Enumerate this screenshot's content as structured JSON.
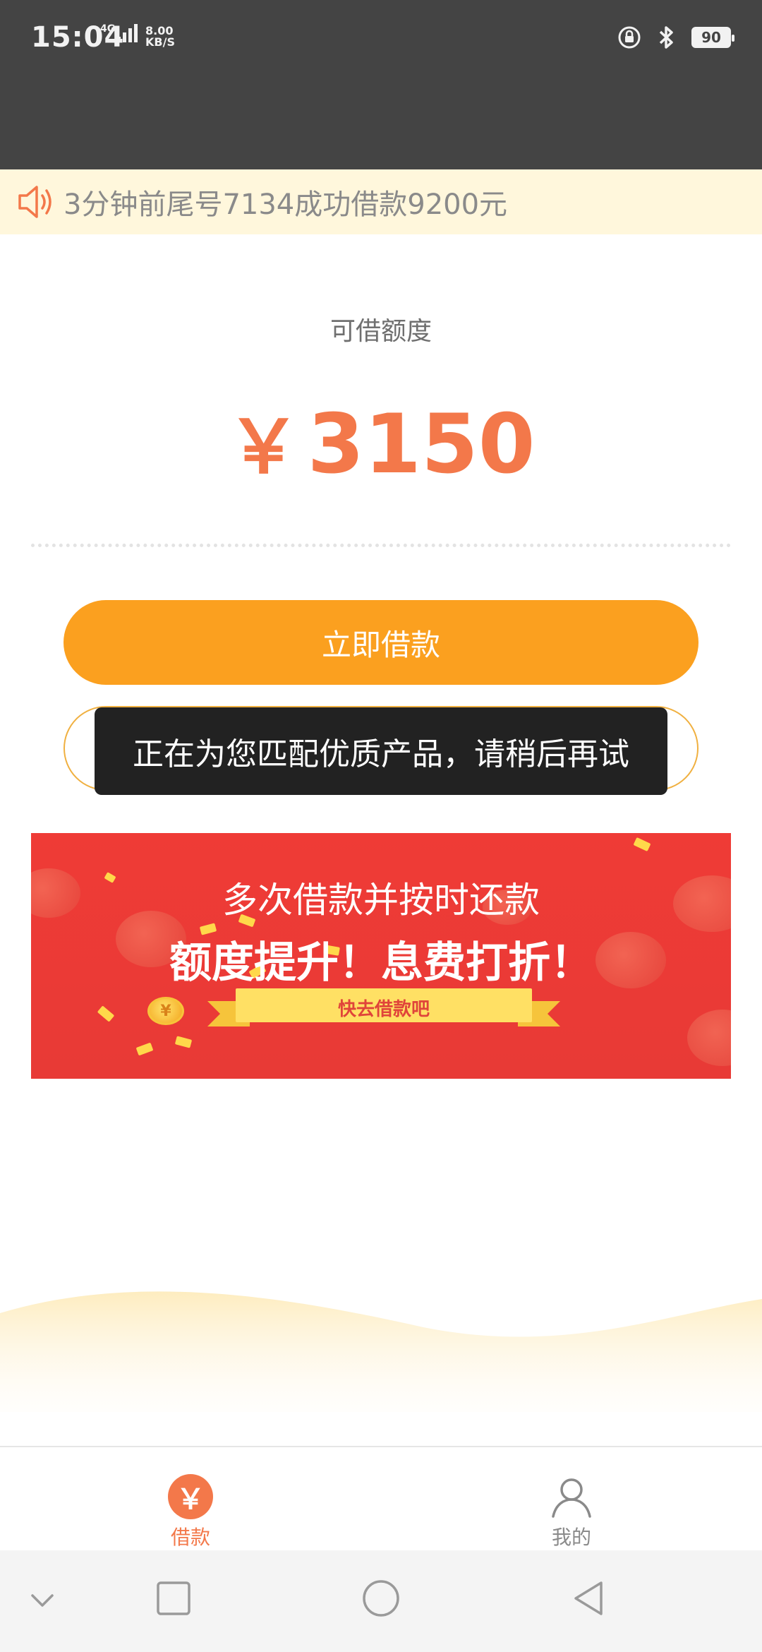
{
  "status_bar": {
    "time": "15:04",
    "network": "4G",
    "speed_value": "8.00",
    "speed_unit": "KB/S",
    "battery": "90",
    "icons": [
      "lock-rotation-icon",
      "bluetooth-icon",
      "battery-icon"
    ]
  },
  "notice": {
    "icon": "speaker-icon",
    "text": "3分钟前尾号7134成功借款9200元"
  },
  "credit": {
    "label": "可借额度",
    "currency": "￥",
    "amount": "3150"
  },
  "buttons": {
    "borrow_now": "立即借款"
  },
  "toast": {
    "text": "正在为您匹配优质产品，请稍后再试"
  },
  "promo": {
    "line1": "多次借款并按时还款",
    "line2": "额度提升！息费打折！",
    "ribbon": "快去借款吧",
    "coin_symbol": "¥"
  },
  "bottom_nav": {
    "items": [
      {
        "label": "借款",
        "icon": "yen-icon",
        "active": true
      },
      {
        "label": "我的",
        "icon": "user-icon",
        "active": false
      }
    ]
  },
  "colors": {
    "accent": "#f3784a",
    "primary_button": "#fba01f",
    "banner_red": "#e83a36",
    "notice_bg": "#fff7dc"
  }
}
